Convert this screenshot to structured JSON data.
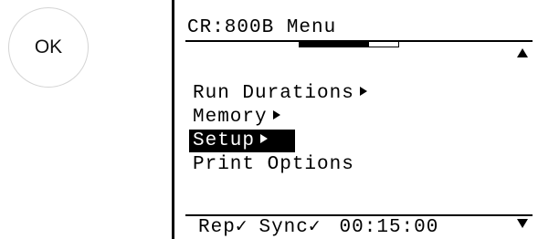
{
  "ok_button": {
    "label": "OK"
  },
  "screen": {
    "title": "CR:800B Menu",
    "progress": 0.7,
    "scroll_icons": [
      "scroll-up-arrow-icon",
      "scroll-down-arrow-icon"
    ],
    "menu_items": [
      {
        "label": "Run Durations",
        "has_submenu": true,
        "selected": false
      },
      {
        "label": "Memory",
        "has_submenu": true,
        "selected": false
      },
      {
        "label": "Setup",
        "has_submenu": true,
        "selected": true
      },
      {
        "label": "Print Options",
        "has_submenu": false,
        "selected": false
      }
    ],
    "status_bar": {
      "rep_label": "Rep",
      "sync_label": "Sync",
      "check_glyph": "✓",
      "time": "00:15:00"
    }
  },
  "colors": {
    "lcd_background": "#ffffff",
    "lcd_foreground": "#000000",
    "button_border": "#d4d4d4"
  }
}
